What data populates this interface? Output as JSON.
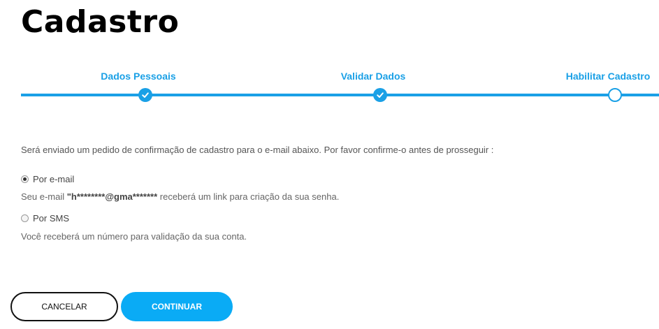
{
  "page": {
    "title": "Cadastro"
  },
  "stepper": {
    "steps": [
      {
        "label": "Dados Pessoais",
        "status": "done"
      },
      {
        "label": "Validar Dados",
        "status": "done"
      },
      {
        "label": "Habilitar Cadastro",
        "status": "current"
      }
    ],
    "color": "#1aa0e6"
  },
  "form": {
    "intro": "Será enviado um pedido de confirmação de cadastro para o e-mail abaixo. Por favor confirme-o antes de prosseguir :",
    "email_option": {
      "label": "Por e-mail",
      "checked": true,
      "desc_prefix": "Seu e-mail ",
      "masked_email": "\"h********@gma*******",
      "desc_suffix": " receberá um link para criação da sua senha."
    },
    "sms_option": {
      "label": "Por SMS",
      "checked": false,
      "desc": "Você receberá um número para validação da sua conta."
    }
  },
  "actions": {
    "cancel_label": "CANCELAR",
    "continue_label": "CONTINUAR",
    "continue_color": "#0aabf5"
  }
}
